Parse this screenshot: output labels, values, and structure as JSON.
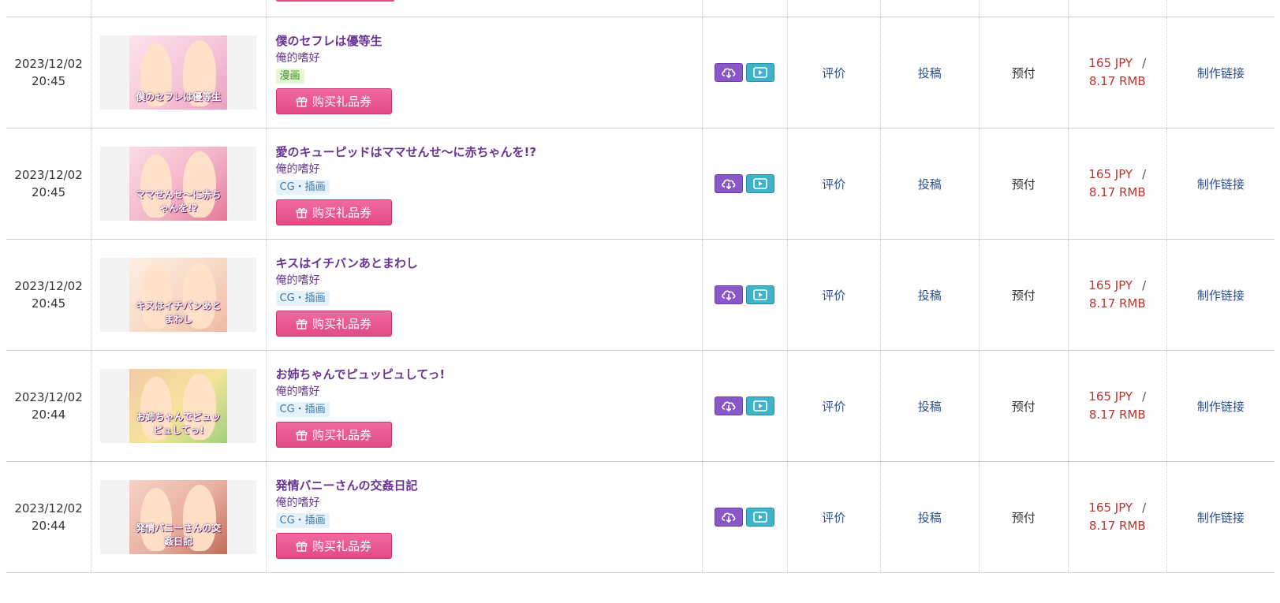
{
  "columns_note": "",
  "gift_button_label": "购买礼品券",
  "review_label": "评价",
  "post_label": "投稿",
  "prepay_label": "预付",
  "make_link_label": "制作链接",
  "icons": {
    "download": "cloud-download-icon",
    "preview": "play-icon",
    "gift": "gift-icon"
  },
  "colors": {
    "title": "#6a3495",
    "gift_button": "#e24a84",
    "download_button": "#8a57c8",
    "preview_button": "#3fb3c9",
    "price": "#b6362e",
    "link": "#2b4f8c"
  },
  "rows": [
    {
      "date": "2023/12/02",
      "time": "20:45",
      "title": "僕のセフレは優等生",
      "circle": "俺的嗜好",
      "category": "漫画",
      "thumb_caption": "僕のセフレは優等生",
      "price_jpy": "165 JPY",
      "price_sep": "/",
      "price_rmb": "8.17 RMB"
    },
    {
      "date": "2023/12/02",
      "time": "20:45",
      "title": "愛のキューピッドはママせんせ～に赤ちゃんを!?",
      "circle": "俺的嗜好",
      "category": "CG・插画",
      "thumb_caption": "ママせんせ～に赤ちゃんを!?",
      "price_jpy": "165 JPY",
      "price_sep": "/",
      "price_rmb": "8.17 RMB"
    },
    {
      "date": "2023/12/02",
      "time": "20:45",
      "title": "キスはイチバンあとまわし",
      "circle": "俺的嗜好",
      "category": "CG・插画",
      "thumb_caption": "キスはイチバンあとまわし",
      "price_jpy": "165 JPY",
      "price_sep": "/",
      "price_rmb": "8.17 RMB"
    },
    {
      "date": "2023/12/02",
      "time": "20:44",
      "title": "お姉ちゃんでピュッピュしてっ!",
      "circle": "俺的嗜好",
      "category": "CG・插画",
      "thumb_caption": "お姉ちゃんでピュッピュしてっ!",
      "price_jpy": "165 JPY",
      "price_sep": "/",
      "price_rmb": "8.17 RMB"
    },
    {
      "date": "2023/12/02",
      "time": "20:44",
      "title": "発情バニーさんの交姦日記",
      "circle": "俺的嗜好",
      "category": "CG・插画",
      "thumb_caption": "発情バニーさんの交姦日記",
      "price_jpy": "165 JPY",
      "price_sep": "/",
      "price_rmb": "8.17 RMB"
    }
  ]
}
